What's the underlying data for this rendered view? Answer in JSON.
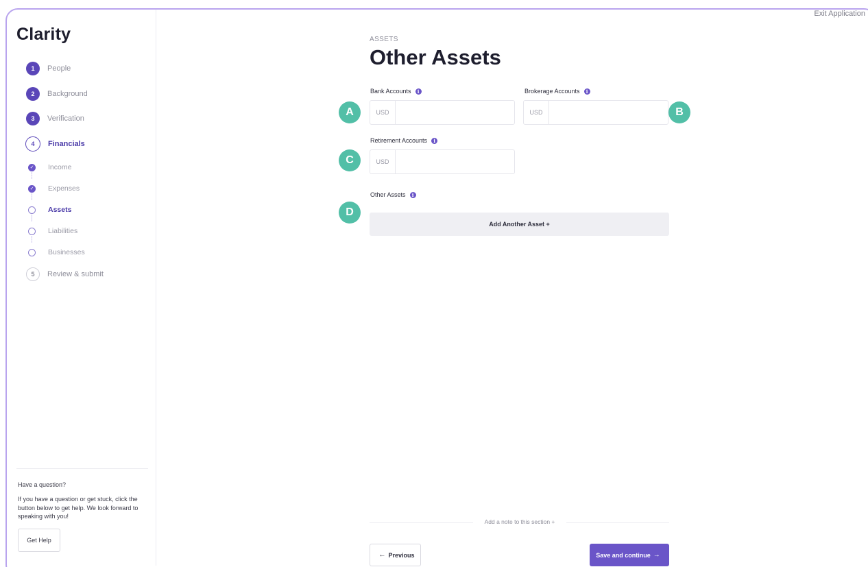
{
  "header": {
    "exit_label": "Exit Application"
  },
  "sidebar": {
    "brand": "Clarity",
    "steps": [
      {
        "num": "1",
        "label": "People"
      },
      {
        "num": "2",
        "label": "Background"
      },
      {
        "num": "3",
        "label": "Verification"
      },
      {
        "num": "4",
        "label": "Financials"
      }
    ],
    "substeps": [
      {
        "label": "Income",
        "check": "✓"
      },
      {
        "label": "Expenses",
        "check": "✓"
      },
      {
        "label": "Assets"
      },
      {
        "label": "Liabilities"
      },
      {
        "label": "Businesses"
      }
    ],
    "final_step": {
      "num": "5",
      "label": "Review & submit"
    },
    "help": {
      "title": "Have a question?",
      "text": "If you have a question or get stuck, click the button below to get help. We look forward to speaking with you!",
      "button": "Get Help"
    }
  },
  "main": {
    "eyebrow": "ASSETS",
    "title": "Other Assets",
    "fields": {
      "bank": {
        "label": "Bank Accounts",
        "currency": "USD",
        "value": ""
      },
      "brokerage": {
        "label": "Brokerage Accounts",
        "currency": "USD",
        "value": ""
      },
      "retirement": {
        "label": "Retirement Accounts",
        "currency": "USD",
        "value": ""
      },
      "other": {
        "label": "Other Assets"
      }
    },
    "info_glyph": "i",
    "add_asset_label": "Add Another Asset +",
    "markers": {
      "a": "A",
      "b": "B",
      "c": "C",
      "d": "D"
    },
    "note_label": "Add a note to this section +",
    "previous_label": "Previous",
    "save_label": "Save and continue",
    "arrow_left": "←",
    "arrow_right": "→"
  },
  "colors": {
    "accent": "#6a55c8",
    "frame": "#b9a4ee",
    "marker": "#52bfa7"
  }
}
